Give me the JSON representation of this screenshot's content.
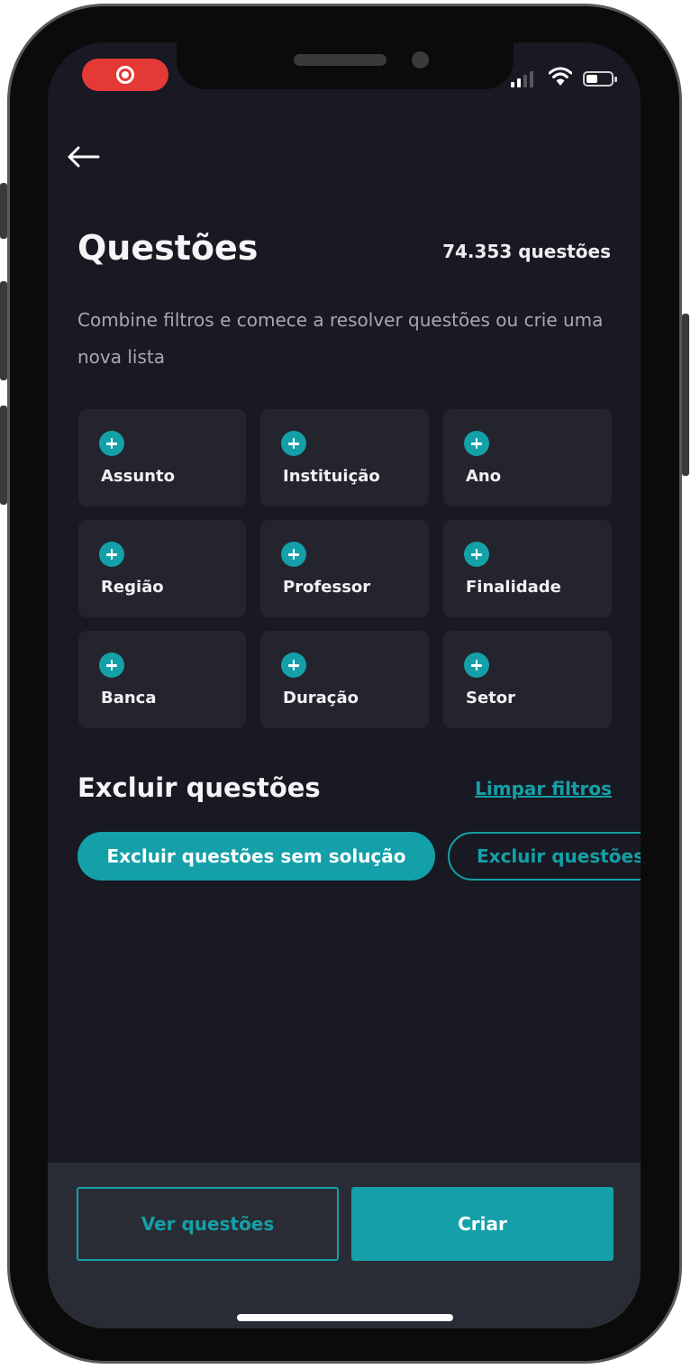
{
  "status_bar": {
    "recording_icon": "record-icon",
    "signal_icon": "cellular-signal-icon",
    "wifi_icon": "wifi-icon",
    "battery_icon": "battery-icon"
  },
  "header": {
    "back_icon": "arrow-left-icon",
    "title": "Questões",
    "count": "74.353 questões",
    "description": "Combine filtros e comece a resolver questões ou crie uma nova lista"
  },
  "filters": [
    {
      "label": "Assunto",
      "icon": "plus-circle-icon"
    },
    {
      "label": "Instituição",
      "icon": "plus-circle-icon"
    },
    {
      "label": "Ano",
      "icon": "plus-circle-icon"
    },
    {
      "label": "Região",
      "icon": "plus-circle-icon"
    },
    {
      "label": "Professor",
      "icon": "plus-circle-icon"
    },
    {
      "label": "Finalidade",
      "icon": "plus-circle-icon"
    },
    {
      "label": "Banca",
      "icon": "plus-circle-icon"
    },
    {
      "label": "Duração",
      "icon": "plus-circle-icon"
    },
    {
      "label": "Setor",
      "icon": "plus-circle-icon"
    }
  ],
  "exclude": {
    "title": "Excluir questões",
    "clear_link": "Limpar filtros",
    "chips": [
      {
        "label": "Excluir questões sem solução",
        "selected": true
      },
      {
        "label": "Excluir questões",
        "selected": false
      }
    ]
  },
  "footer": {
    "view_button": "Ver questões",
    "create_button": "Criar"
  },
  "colors": {
    "accent": "#14a0a8",
    "background": "#181922",
    "card": "#23242d",
    "footer": "#2a2c35",
    "record": "#e53935"
  }
}
